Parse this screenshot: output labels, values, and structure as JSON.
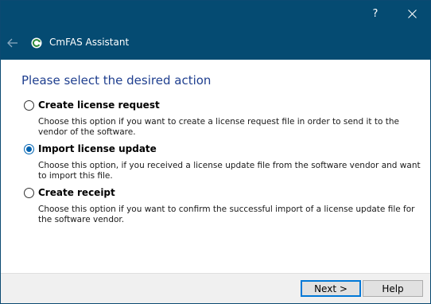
{
  "title_bar": {
    "help_glyph": "?",
    "app_title": "CmFAS Assistant",
    "accent": "#054b72"
  },
  "heading": "Please select the desired action",
  "options": [
    {
      "label": "Create license request",
      "description": "Choose this option if you want to create a license request file in order to send it to the vendor of the software.",
      "selected": false
    },
    {
      "label": "Import license update",
      "description": "Choose this option, if you received a license update file from the software vendor and want to import this file.",
      "selected": true
    },
    {
      "label": "Create receipt",
      "description": "Choose this option if you want to confirm the successful import of a license update file for the software vendor.",
      "selected": false
    }
  ],
  "buttons": {
    "next": "Next >",
    "help": "Help"
  },
  "icons": {
    "close": "close-icon",
    "back": "back-arrow-icon",
    "app": "codemeter-icon",
    "radio_checked_color": "#0063b1"
  }
}
